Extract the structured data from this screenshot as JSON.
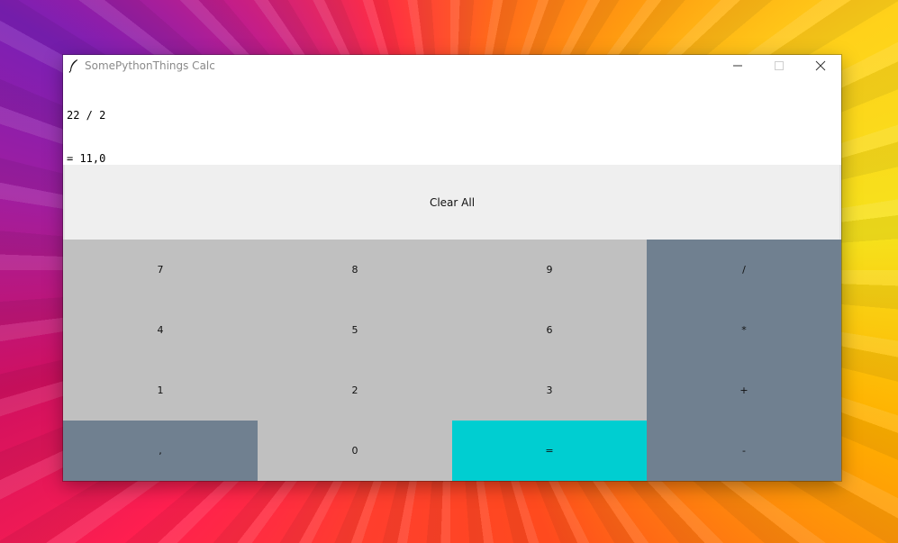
{
  "window": {
    "title": "SomePythonThings Calc",
    "controls": {
      "minimize": "minimize-icon",
      "maximize": "maximize-icon",
      "close": "close-icon"
    }
  },
  "display": {
    "lines": [
      "22 / 2",
      "= 11,0"
    ]
  },
  "clear_button": {
    "label": "Clear All"
  },
  "keys": {
    "row1": [
      "7",
      "8",
      "9",
      "/"
    ],
    "row2": [
      "4",
      "5",
      "6",
      "*"
    ],
    "row3": [
      "1",
      "2",
      "3",
      "+"
    ],
    "row4": [
      ",",
      "0",
      "=",
      "-"
    ]
  },
  "colors": {
    "number_key": "#c0c0c0",
    "operator_key": "#708090",
    "equals_key": "#00ced1",
    "clear_button": "#efefef"
  }
}
